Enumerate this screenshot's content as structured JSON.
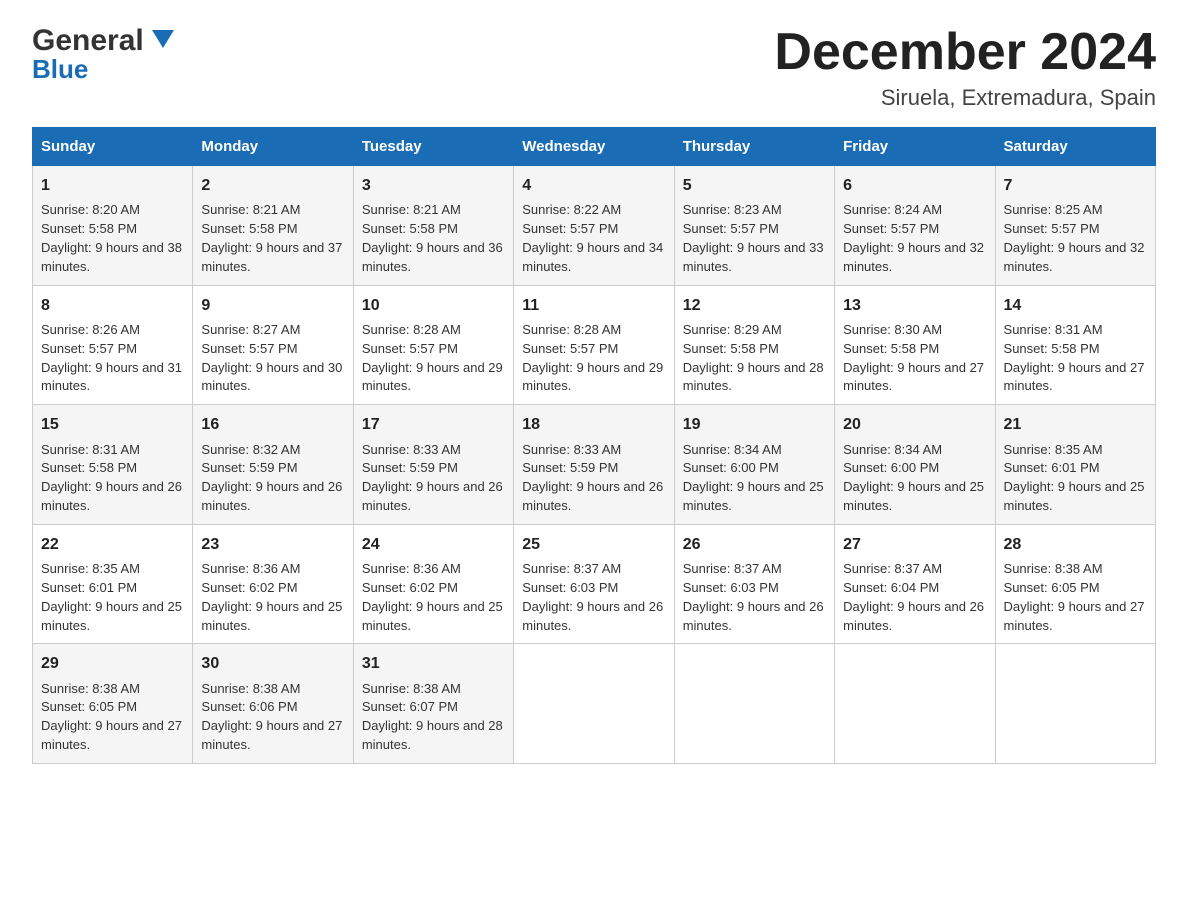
{
  "header": {
    "logo_general": "General",
    "logo_blue": "Blue",
    "title": "December 2024",
    "location": "Siruela, Extremadura, Spain"
  },
  "columns": [
    "Sunday",
    "Monday",
    "Tuesday",
    "Wednesday",
    "Thursday",
    "Friday",
    "Saturday"
  ],
  "weeks": [
    [
      {
        "day": "1",
        "sunrise": "8:20 AM",
        "sunset": "5:58 PM",
        "daylight": "9 hours and 38 minutes."
      },
      {
        "day": "2",
        "sunrise": "8:21 AM",
        "sunset": "5:58 PM",
        "daylight": "9 hours and 37 minutes."
      },
      {
        "day": "3",
        "sunrise": "8:21 AM",
        "sunset": "5:58 PM",
        "daylight": "9 hours and 36 minutes."
      },
      {
        "day": "4",
        "sunrise": "8:22 AM",
        "sunset": "5:57 PM",
        "daylight": "9 hours and 34 minutes."
      },
      {
        "day": "5",
        "sunrise": "8:23 AM",
        "sunset": "5:57 PM",
        "daylight": "9 hours and 33 minutes."
      },
      {
        "day": "6",
        "sunrise": "8:24 AM",
        "sunset": "5:57 PM",
        "daylight": "9 hours and 32 minutes."
      },
      {
        "day": "7",
        "sunrise": "8:25 AM",
        "sunset": "5:57 PM",
        "daylight": "9 hours and 32 minutes."
      }
    ],
    [
      {
        "day": "8",
        "sunrise": "8:26 AM",
        "sunset": "5:57 PM",
        "daylight": "9 hours and 31 minutes."
      },
      {
        "day": "9",
        "sunrise": "8:27 AM",
        "sunset": "5:57 PM",
        "daylight": "9 hours and 30 minutes."
      },
      {
        "day": "10",
        "sunrise": "8:28 AM",
        "sunset": "5:57 PM",
        "daylight": "9 hours and 29 minutes."
      },
      {
        "day": "11",
        "sunrise": "8:28 AM",
        "sunset": "5:57 PM",
        "daylight": "9 hours and 29 minutes."
      },
      {
        "day": "12",
        "sunrise": "8:29 AM",
        "sunset": "5:58 PM",
        "daylight": "9 hours and 28 minutes."
      },
      {
        "day": "13",
        "sunrise": "8:30 AM",
        "sunset": "5:58 PM",
        "daylight": "9 hours and 27 minutes."
      },
      {
        "day": "14",
        "sunrise": "8:31 AM",
        "sunset": "5:58 PM",
        "daylight": "9 hours and 27 minutes."
      }
    ],
    [
      {
        "day": "15",
        "sunrise": "8:31 AM",
        "sunset": "5:58 PM",
        "daylight": "9 hours and 26 minutes."
      },
      {
        "day": "16",
        "sunrise": "8:32 AM",
        "sunset": "5:59 PM",
        "daylight": "9 hours and 26 minutes."
      },
      {
        "day": "17",
        "sunrise": "8:33 AM",
        "sunset": "5:59 PM",
        "daylight": "9 hours and 26 minutes."
      },
      {
        "day": "18",
        "sunrise": "8:33 AM",
        "sunset": "5:59 PM",
        "daylight": "9 hours and 26 minutes."
      },
      {
        "day": "19",
        "sunrise": "8:34 AM",
        "sunset": "6:00 PM",
        "daylight": "9 hours and 25 minutes."
      },
      {
        "day": "20",
        "sunrise": "8:34 AM",
        "sunset": "6:00 PM",
        "daylight": "9 hours and 25 minutes."
      },
      {
        "day": "21",
        "sunrise": "8:35 AM",
        "sunset": "6:01 PM",
        "daylight": "9 hours and 25 minutes."
      }
    ],
    [
      {
        "day": "22",
        "sunrise": "8:35 AM",
        "sunset": "6:01 PM",
        "daylight": "9 hours and 25 minutes."
      },
      {
        "day": "23",
        "sunrise": "8:36 AM",
        "sunset": "6:02 PM",
        "daylight": "9 hours and 25 minutes."
      },
      {
        "day": "24",
        "sunrise": "8:36 AM",
        "sunset": "6:02 PM",
        "daylight": "9 hours and 25 minutes."
      },
      {
        "day": "25",
        "sunrise": "8:37 AM",
        "sunset": "6:03 PM",
        "daylight": "9 hours and 26 minutes."
      },
      {
        "day": "26",
        "sunrise": "8:37 AM",
        "sunset": "6:03 PM",
        "daylight": "9 hours and 26 minutes."
      },
      {
        "day": "27",
        "sunrise": "8:37 AM",
        "sunset": "6:04 PM",
        "daylight": "9 hours and 26 minutes."
      },
      {
        "day": "28",
        "sunrise": "8:38 AM",
        "sunset": "6:05 PM",
        "daylight": "9 hours and 27 minutes."
      }
    ],
    [
      {
        "day": "29",
        "sunrise": "8:38 AM",
        "sunset": "6:05 PM",
        "daylight": "9 hours and 27 minutes."
      },
      {
        "day": "30",
        "sunrise": "8:38 AM",
        "sunset": "6:06 PM",
        "daylight": "9 hours and 27 minutes."
      },
      {
        "day": "31",
        "sunrise": "8:38 AM",
        "sunset": "6:07 PM",
        "daylight": "9 hours and 28 minutes."
      },
      null,
      null,
      null,
      null
    ]
  ]
}
